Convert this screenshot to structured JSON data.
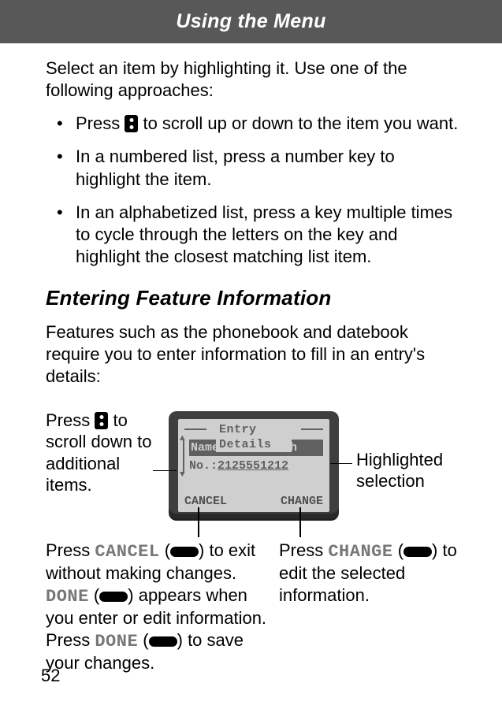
{
  "header": {
    "title": "Using the Menu"
  },
  "intro": "Select an item by highlighting it. Use one of the following approaches:",
  "bullets": {
    "b1_pre": "Press ",
    "b1_post": " to scroll up or down to the item you want.",
    "b2": "In a numbered list, press a number key to highlight the item.",
    "b3": "In an alphabetized list, press a key multiple times to cycle through the letters on the key and highlight the closest matching list item."
  },
  "section_heading": "Entering Feature Information",
  "feature_intro": "Features such as the phonebook and datebook require you to enter information to fill in an entry's details:",
  "notes": {
    "scroll_pre": "Press ",
    "scroll_post": " to scroll down to additional items.",
    "highlight": "Highlighted selection",
    "cancel_label": "CANCEL",
    "cancel_p1_pre": "Press ",
    "cancel_p1_mid": " (",
    "cancel_p1_post": ") to exit without making changes.",
    "done_label": "DONE",
    "cancel_p2a": " (",
    "cancel_p2b": ") appears when you enter or edit information. Press ",
    "cancel_p2c": " (",
    "cancel_p2d": ") to save your changes.",
    "change_label": "CHANGE",
    "change_pre": "Press ",
    "change_mid": " (",
    "change_post": ") to edit the selected information."
  },
  "phone": {
    "title": "Entry Details",
    "row1": "Name:John Smith",
    "row2_label": "No.:",
    "row2_value": "2125551212",
    "soft_left": "CANCEL",
    "soft_right": "CHANGE"
  },
  "page": "52"
}
